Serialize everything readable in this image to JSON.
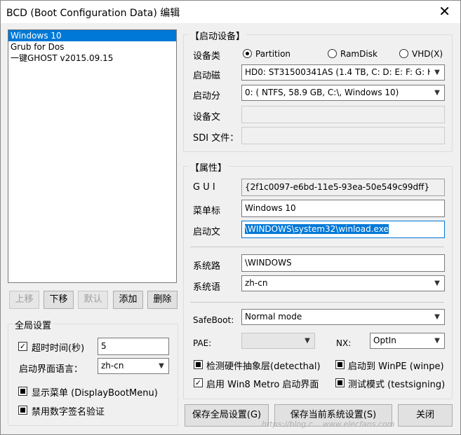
{
  "window": {
    "title": "BCD (Boot Configuration Data) 编辑",
    "close_glyph": "✕"
  },
  "entries": [
    "Windows 10",
    "Grub for Dos",
    "一键GHOST v2015.09.15"
  ],
  "list_buttons": {
    "up": "上移",
    "down": "下移",
    "default": "默认",
    "add": "添加",
    "delete": "删除"
  },
  "global": {
    "title": "全局设置",
    "timeout_label": "超时时间(秒)",
    "timeout_value": "5",
    "boot_lang_label": "启动界面语言：",
    "boot_lang_value": "zh-cn",
    "show_menu": "显示菜单 (DisplayBootMenu)",
    "disable_sig": "禁用数字签名验证"
  },
  "boot_device": {
    "title": "【启动设备】",
    "device_type_label": "设备类",
    "radio_partition": "Partition",
    "radio_ramdisk": "RamDisk",
    "radio_vhd": "VHD(X)",
    "boot_disk_label": "启动磁",
    "boot_disk_value": "HD0: ST31500341AS (1.4 TB, C: D: E: F: G: H",
    "boot_part_label": "启动分",
    "boot_part_value": "0: ( NTFS,  58.9 GB, C:\\, Windows 10)",
    "device_file_label": "设备文",
    "sdi_label": "SDI 文件："
  },
  "props": {
    "title": "【属性】",
    "guid_label": "G U I",
    "guid_value": "{2f1c0097-e6bd-11e5-93ea-50e549c99dff}",
    "menu_label": "菜单标",
    "menu_value": "Windows 10",
    "bootfile_label": "启动文",
    "bootfile_value": "\\WINDOWS\\system32\\winload.exe",
    "syspath_label": "系统路",
    "syspath_value": "\\WINDOWS",
    "syslang_label": "系统语",
    "syslang_value": "zh-cn",
    "safeboot_label": "SafeBoot:",
    "safeboot_value": "Normal mode",
    "pae_label": "PAE:",
    "pae_value": "",
    "nx_label": "NX:",
    "nx_value": "OptIn",
    "detecthal": "检测硬件抽象层(detecthal)",
    "winpe": "启动到 WinPE (winpe)",
    "metro": "启用 Win8 Metro 启动界面",
    "testsigning": "测试模式 (testsigning)"
  },
  "bottom": {
    "save_global": "保存全局设置(G)",
    "save_current": "保存当前系统设置(S)",
    "close": "关闭"
  },
  "watermark": "https://blog.c...   www.elecfans.com"
}
